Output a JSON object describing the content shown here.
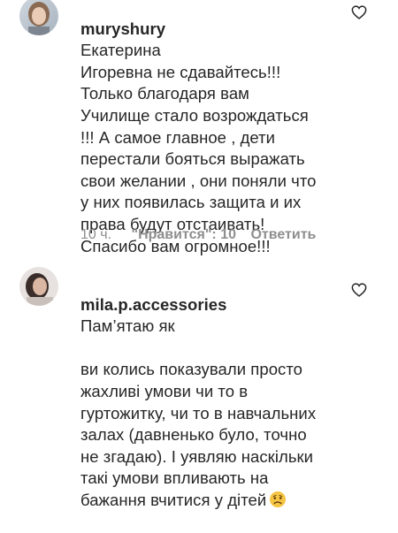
{
  "comments": [
    {
      "username": "muryshury",
      "text_first": "Екатерина",
      "text_rest": "Игоревна не сдавайтесь!!!\nТолько благодаря вам\nУчилище стало возрождаться\n!!! А самое главное , дети\nперестали бояться выражать\nсвои желании , они поняли что\nу них появилась защита и их\nправа будут отстаивать!\nСпасибо вам огромное!!!",
      "time": "10 ч.",
      "likes": "\"Нравится\": 10",
      "reply": "Ответить",
      "avatar_icon": "profile-photo",
      "like_icon": "heart-outline-icon"
    },
    {
      "username": "mila.p.accessories",
      "text_first": "Пам’ятаю як",
      "text_rest": "ви колись показували просто\nжахливі умови чи то в\nгуртожитку, чи то в навчальних\nзалах (давненько було, точно\nне згадаю). І уявляю наскільки\nтакі умови впливають на\nбажання вчитися у дітей",
      "emoji": "sad-face-emoji",
      "avatar_icon": "profile-photo",
      "like_icon": "heart-outline-icon"
    }
  ],
  "colors": {
    "text": "#262626",
    "meta": "#8e8e8e",
    "emoji": "#f5c443"
  }
}
